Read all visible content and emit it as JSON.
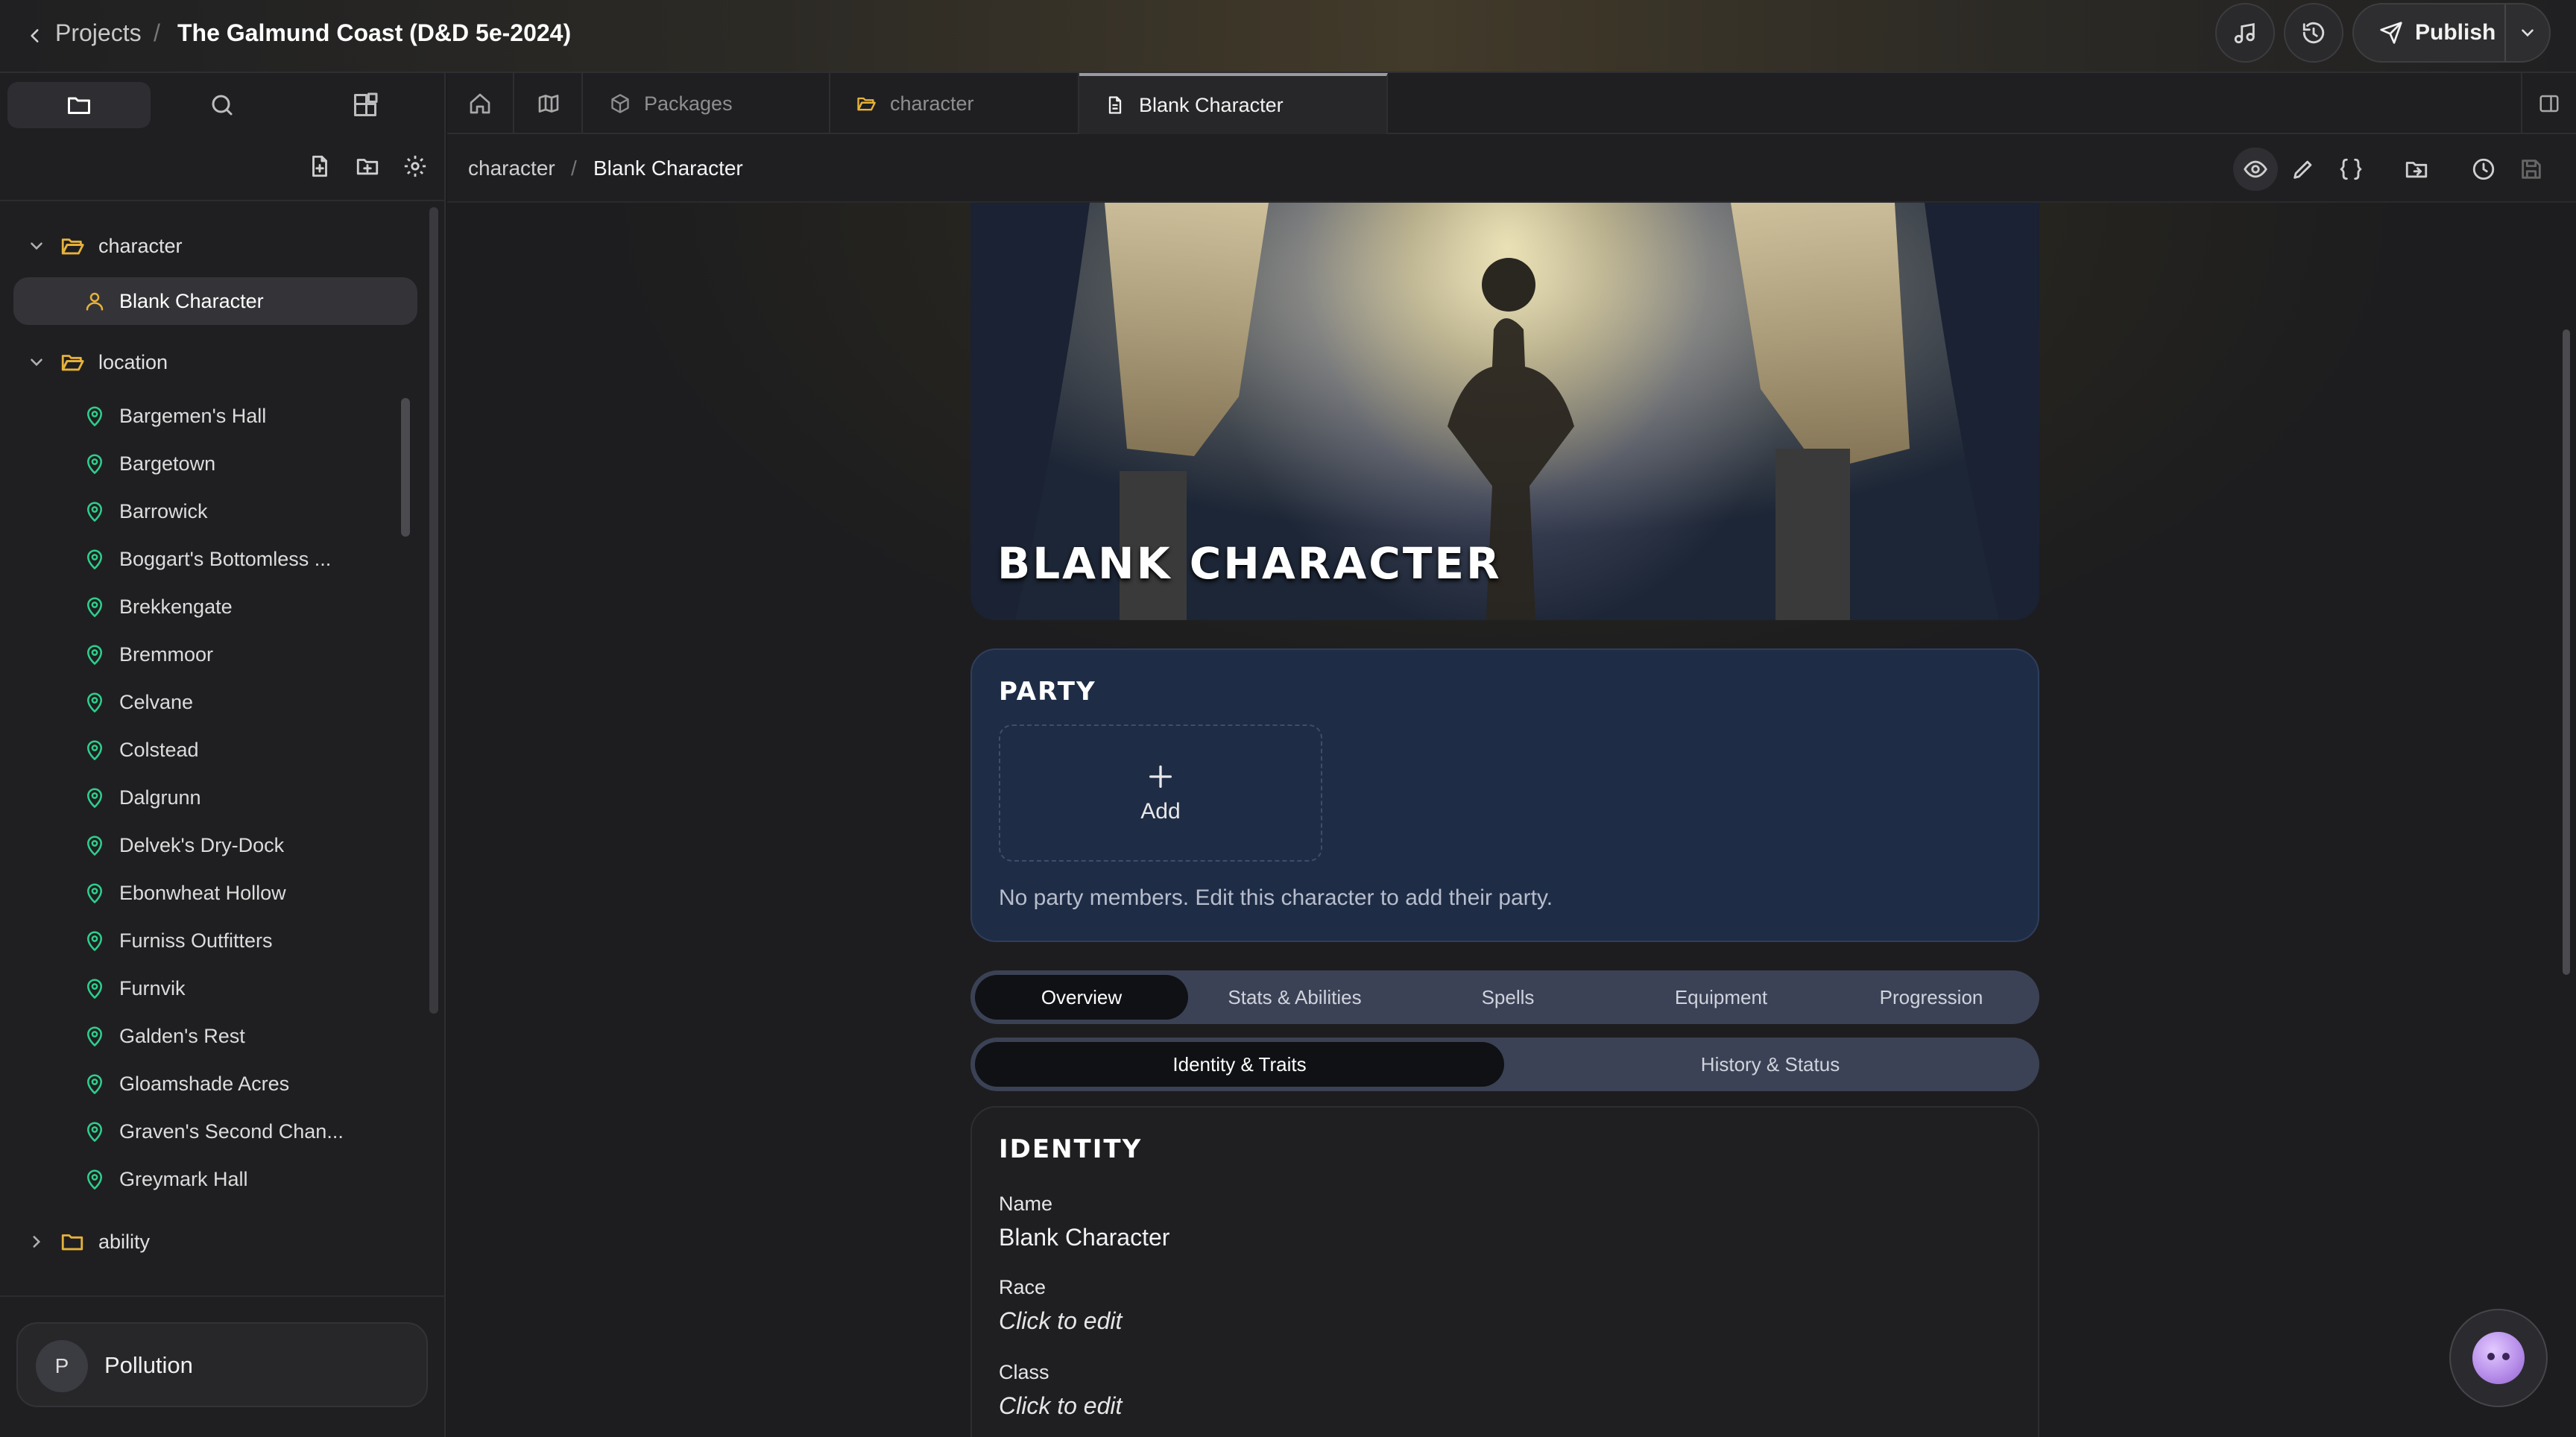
{
  "topbar": {
    "back_label": "Projects",
    "separator": "/",
    "project_title": "The Galmund Coast (D&D 5e-2024)",
    "publish_label": "Publish"
  },
  "sidebar": {
    "tree": {
      "character_folder": "character",
      "character_items": [
        "Blank Character"
      ],
      "location_folder": "location",
      "location_items": [
        "Bargemen's Hall",
        "Bargetown",
        "Barrowick",
        "Boggart's Bottomless ...",
        "Brekkengate",
        "Bremmoor",
        "Celvane",
        "Colstead",
        "Dalgrunn",
        "Delvek's Dry-Dock",
        "Ebonwheat Hollow",
        "Furniss Outfitters",
        "Furnvik",
        "Galden's Rest",
        "Gloamshade Acres",
        "Graven's Second Chan...",
        "Greymark Hall"
      ],
      "ability_folder": "ability"
    },
    "user": {
      "initial": "P",
      "name": "Pollution"
    }
  },
  "tabs": [
    {
      "label": "Packages",
      "icon": "package-icon"
    },
    {
      "label": "character",
      "icon": "folder-icon"
    },
    {
      "label": "Blank Character",
      "icon": "document-icon",
      "active": true
    }
  ],
  "breadcrumb": {
    "parent": "character",
    "separator": "/",
    "current": "Blank Character"
  },
  "hero": {
    "title": "BLANK CHARACTER"
  },
  "party": {
    "title": "PARTY",
    "add_label": "Add",
    "empty_text": "No party members. Edit this character to add their party."
  },
  "main_tabs": [
    "Overview",
    "Stats & Abilities",
    "Spells",
    "Equipment",
    "Progression"
  ],
  "sub_tabs": [
    "Identity & Traits",
    "History & Status"
  ],
  "identity": {
    "title": "IDENTITY",
    "fields": [
      {
        "label": "Name",
        "value": "Blank Character"
      },
      {
        "label": "Race",
        "value": "Click to edit"
      },
      {
        "label": "Class",
        "value": "Click to edit"
      }
    ]
  },
  "colors": {
    "accent_location": "#2ecf8a",
    "accent_folder": "#e6b23a",
    "party_bg": "#1f2c46"
  }
}
